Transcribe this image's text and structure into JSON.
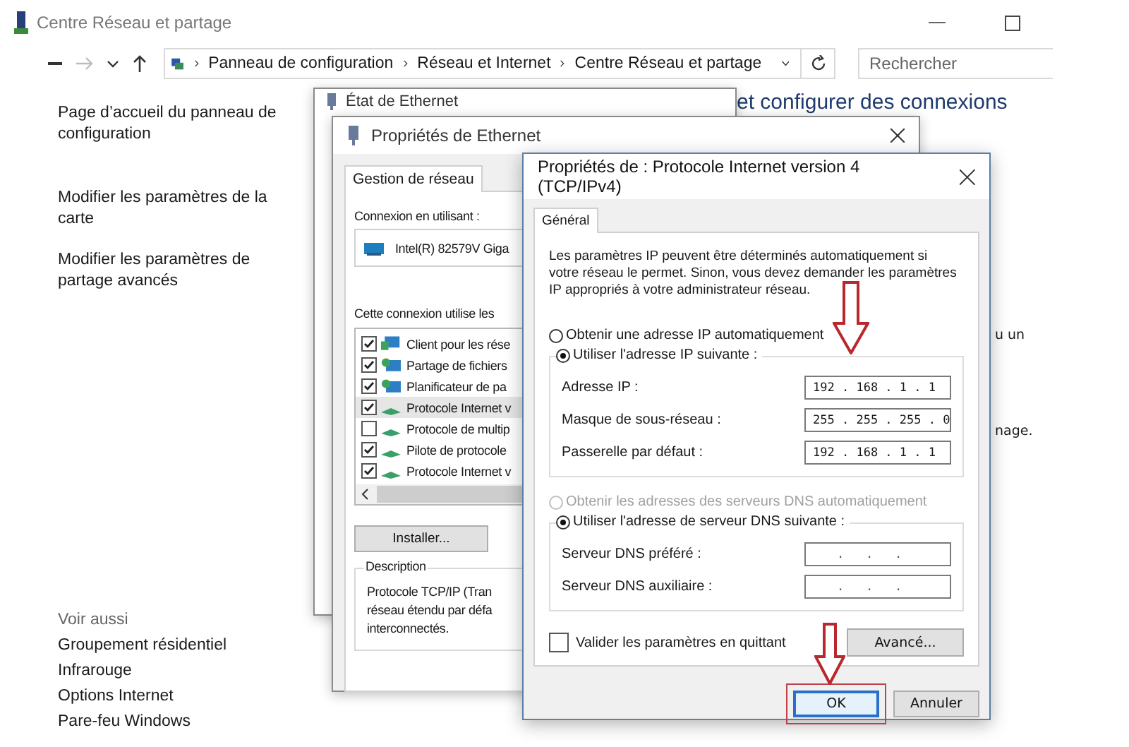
{
  "window": {
    "title": "Centre Réseau et partage"
  },
  "address_bar": {
    "breadcrumbs": [
      "Panneau de configuration",
      "Réseau et Internet",
      "Centre Réseau et partage"
    ]
  },
  "search": {
    "placeholder": "Rechercher"
  },
  "sidebar": {
    "links": [
      "Page d’accueil du panneau de configuration",
      "Modifier les paramètres de la carte",
      "Modifier les paramètres de partage avancés"
    ],
    "see_also_heading": "Voir aussi",
    "see_also": [
      "Groupement résidentiel",
      "Infrarouge",
      "Options Internet",
      "Pare-feu Windows"
    ]
  },
  "main_fragments": [
    {
      "text": "et configurer des connexions",
      "kind": "heading"
    },
    {
      "text": "u un",
      "kind": "body"
    },
    {
      "text": "nage.",
      "kind": "body"
    }
  ],
  "status_window": {
    "title": "État de Ethernet"
  },
  "ethernet_properties": {
    "title": "Propriétés de Ethernet",
    "tabs": [
      {
        "label": "Gestion de réseau",
        "selected": true
      }
    ],
    "connect_using_label": "Connexion en utilisant :",
    "adapter": "Intel(R) 82579V Giga",
    "items_label": "Cette connexion utilise les",
    "items": [
      {
        "label": "Client pour les rése",
        "checked": true,
        "selected": false,
        "kind": "client"
      },
      {
        "label": "Partage de fichiers",
        "checked": true,
        "selected": false,
        "kind": "service"
      },
      {
        "label": "Planificateur de pa",
        "checked": true,
        "selected": false,
        "kind": "service"
      },
      {
        "label": "Protocole Internet v",
        "checked": true,
        "selected": true,
        "kind": "protocol"
      },
      {
        "label": "Protocole de multip",
        "checked": false,
        "selected": false,
        "kind": "protocol"
      },
      {
        "label": "Pilote de protocole",
        "checked": true,
        "selected": false,
        "kind": "protocol"
      },
      {
        "label": "Protocole Internet v",
        "checked": true,
        "selected": false,
        "kind": "protocol"
      }
    ],
    "install_button": "Installer...",
    "description_heading": "Description",
    "description_lines": [
      "Protocole TCP/IP (Tran",
      "réseau étendu par défa",
      "interconnectés."
    ]
  },
  "ipv4_dialog": {
    "title": "Propriétés de : Protocole Internet version 4 (TCP/IPv4)",
    "tabs": [
      {
        "label": "Général",
        "selected": true
      }
    ],
    "intro": "Les paramètres IP peuvent être déterminés automatiquement si votre réseau le permet. Sinon, vous devez demander les paramètres IP appropriés à votre administrateur réseau.",
    "ip_auto": {
      "label": "Obtenir une adresse IP automatiquement",
      "selected": false,
      "disabled": false
    },
    "ip_manual": {
      "label": "Utiliser l'adresse IP suivante :",
      "selected": true,
      "disabled": false
    },
    "ip_fields": [
      {
        "label": "Adresse IP :",
        "value": "192 . 168 . 1 . 1"
      },
      {
        "label": "Masque de sous-réseau :",
        "value": "255 . 255 . 255 . 0"
      },
      {
        "label": "Passerelle par défaut :",
        "value": "192 . 168 . 1 . 1"
      }
    ],
    "dns_auto": {
      "label": "Obtenir les adresses des serveurs DNS automatiquement",
      "selected": false,
      "disabled": true
    },
    "dns_manual": {
      "label": "Utiliser l'adresse de serveur DNS suivante :",
      "selected": true,
      "disabled": false
    },
    "dns_fields": [
      {
        "label": "Serveur DNS préféré :",
        "value": ".   .   ."
      },
      {
        "label": "Serveur DNS auxiliaire :",
        "value": ".   .   ."
      }
    ],
    "validate": {
      "label": "Valider les paramètres en quittant",
      "checked": false
    },
    "advanced_button": "Avancé...",
    "buttons": [
      {
        "label": "OK",
        "default": true
      },
      {
        "label": "Annuler",
        "default": false
      }
    ]
  }
}
